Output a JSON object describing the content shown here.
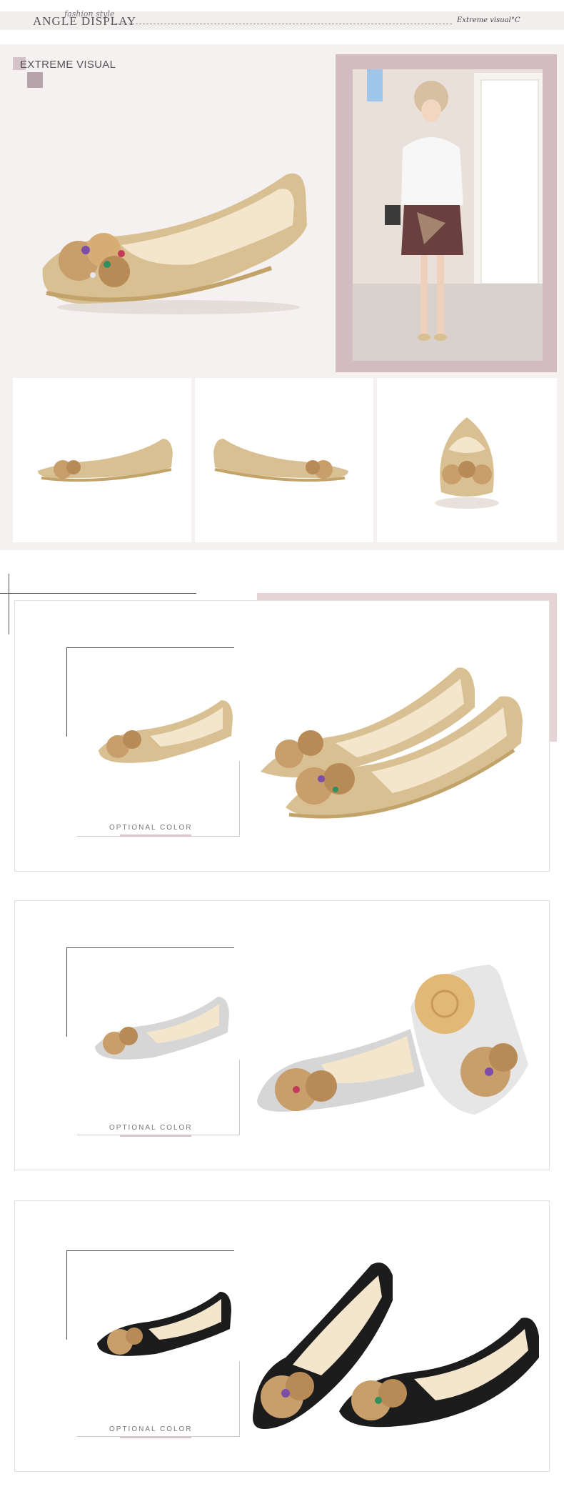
{
  "header": {
    "title": "ANGLE DISPLAY",
    "script_text": "fashion style",
    "right_text": "Extreme visual",
    "right_symbol": "°C"
  },
  "extreme_visual": {
    "label": "EXTREME VISUAL"
  },
  "options": [
    {
      "color": "gold",
      "label": "OPTIONAL COLOR",
      "shoe_color": "#d9c39a"
    },
    {
      "color": "silver",
      "label": "OPTIONAL COLOR",
      "shoe_color": "#d8d8d8"
    },
    {
      "color": "black",
      "label": "OPTIONAL COLOR",
      "shoe_color": "#1c1c1c"
    }
  ],
  "colors": {
    "accent_pink": "#e6d3d6",
    "frame_mauve": "#d2bcc1",
    "background_light": "#f5f1f1"
  }
}
